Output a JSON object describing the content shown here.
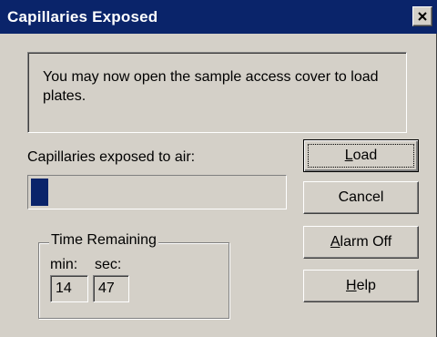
{
  "window": {
    "title": "Capillaries Exposed"
  },
  "message": "You may now open the sample access cover to load plates.",
  "progress": {
    "label": "Capillaries exposed to air:",
    "fraction": 0.07
  },
  "time": {
    "group_label": "Time Remaining",
    "min_label": "min:",
    "sec_label": "sec:",
    "minutes": "14",
    "seconds": "47"
  },
  "buttons": {
    "load": {
      "mnemonic": "L",
      "rest": "oad"
    },
    "cancel": "Cancel",
    "alarm_off": {
      "mnemonic": "A",
      "rest": "larm Off"
    },
    "help": {
      "mnemonic": "H",
      "rest": "elp"
    }
  },
  "colors": {
    "title_bar": "#0a246a",
    "progress_fill": "#0a246a",
    "dialog_face": "#d4d0c8"
  }
}
